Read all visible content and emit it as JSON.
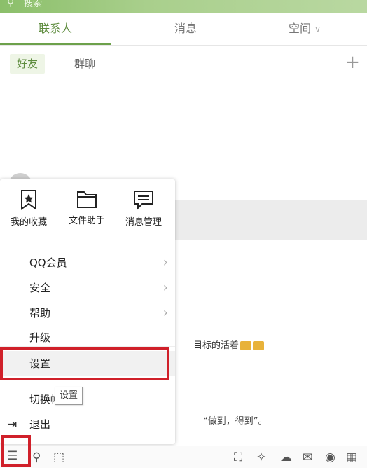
{
  "search": {
    "placeholder": "搜索"
  },
  "tabs": [
    {
      "label": "联系人",
      "active": true
    },
    {
      "label": "消息",
      "active": false
    },
    {
      "label": "空间",
      "active": false
    }
  ],
  "subtabs": [
    {
      "label": "好友",
      "active": true
    },
    {
      "label": "群聊",
      "active": false
    }
  ],
  "contacts_bg": {
    "row2_snippet": "目标的活着",
    "row3_snippet": "“做到，得到”。"
  },
  "menu": {
    "quick_actions": [
      {
        "label": "我的收藏",
        "icon": "bookmark-icon"
      },
      {
        "label": "文件助手",
        "icon": "folder-icon"
      },
      {
        "label": "消息管理",
        "icon": "message-icon"
      }
    ],
    "items": [
      {
        "label": "QQ会员",
        "has_submenu": true
      },
      {
        "label": "安全",
        "has_submenu": true
      },
      {
        "label": "帮助",
        "has_submenu": true
      },
      {
        "label": "升级",
        "has_submenu": false
      },
      {
        "label": "设置",
        "has_submenu": false,
        "selected": true
      },
      {
        "label": "切换帐号",
        "has_submenu": false
      },
      {
        "label": "退出",
        "has_submenu": false
      }
    ]
  },
  "tooltip": {
    "text": "设置"
  },
  "colors": {
    "accent": "#5e8c3e",
    "highlight_box": "#d0202a"
  }
}
